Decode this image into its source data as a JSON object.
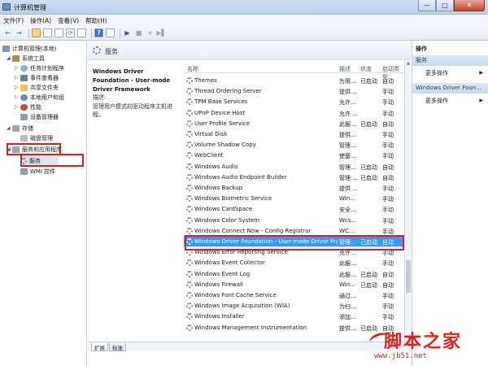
{
  "window": {
    "title": "计算机管理",
    "minimize": "—",
    "maximize": "□",
    "close": "✕"
  },
  "menu": [
    "文件(F)",
    "操作(A)",
    "查看(V)",
    "帮助(H)"
  ],
  "toolbar": {
    "back": "←",
    "forward": "→",
    "play": "▶",
    "stop": "■",
    "pause": "⏸",
    "restart": "▶▌"
  },
  "tree": {
    "root": "计算机管理(本地)",
    "system_tools": "系统工具",
    "task_scheduler": "任务计划程序",
    "event_viewer": "事件查看器",
    "shared_folders": "共享文件夹",
    "local_users": "本地用户和组",
    "performance": "性能",
    "device_manager": "设备管理器",
    "storage": "存储",
    "disk_mgmt": "磁盘管理",
    "services_apps": "服务和应用程序",
    "services": "服务",
    "wmi": "WMI 控件"
  },
  "center": {
    "header": "服务",
    "selected_name": "Windows Driver Foundation - User-mode Driver Framework",
    "desc_label": "描述:",
    "desc_text": "管理用户模式的驱动程序主机进程。"
  },
  "columns": {
    "name": "名称",
    "desc": "描述",
    "status": "状态",
    "startup": "启动类型"
  },
  "services": [
    {
      "name": "Themes",
      "desc": "为用...",
      "status": "已启动",
      "startup": "自动"
    },
    {
      "name": "Thread Ordering Server",
      "desc": "提供...",
      "status": "",
      "startup": "手动"
    },
    {
      "name": "TPM Base Services",
      "desc": "允许...",
      "status": "",
      "startup": "手动"
    },
    {
      "name": "UPnP Device Host",
      "desc": "允许 ...",
      "status": "",
      "startup": "手动"
    },
    {
      "name": "User Profile Service",
      "desc": "此服...",
      "status": "已启动",
      "startup": "自动"
    },
    {
      "name": "Virtual Disk",
      "desc": "提供...",
      "status": "",
      "startup": "手动"
    },
    {
      "name": "Volume Shadow Copy",
      "desc": "管理...",
      "status": "",
      "startup": "手动"
    },
    {
      "name": "WebClient",
      "desc": "使基...",
      "status": "",
      "startup": "手动"
    },
    {
      "name": "Windows Audio",
      "desc": "管理...",
      "status": "已启动",
      "startup": "自动"
    },
    {
      "name": "Windows Audio Endpoint Builder",
      "desc": "管理 ...",
      "status": "已启动",
      "startup": "自动"
    },
    {
      "name": "Windows Backup",
      "desc": "提供 ...",
      "status": "",
      "startup": "手动"
    },
    {
      "name": "Windows Biometric Service",
      "desc": "Win...",
      "status": "",
      "startup": "手动"
    },
    {
      "name": "Windows CardSpace",
      "desc": "安全...",
      "status": "",
      "startup": "手动"
    },
    {
      "name": "Windows Color System",
      "desc": "Wcs...",
      "status": "",
      "startup": "手动"
    },
    {
      "name": "Windows Connect Now - Config Registrar",
      "desc": "WC...",
      "status": "",
      "startup": "手动"
    },
    {
      "name": "Windows Driver Foundation - User-mode Driver Fra...",
      "desc": "管理...",
      "status": "已启动",
      "startup": "自动"
    },
    {
      "name": "Windows Error Reporting Service",
      "desc": "允许...",
      "status": "",
      "startup": "手动"
    },
    {
      "name": "Windows Event Collector",
      "desc": "此服...",
      "status": "",
      "startup": "手动"
    },
    {
      "name": "Windows Event Log",
      "desc": "此服...",
      "status": "已启动",
      "startup": "自动"
    },
    {
      "name": "Windows Firewall",
      "desc": "Win...",
      "status": "已启动",
      "startup": "自动"
    },
    {
      "name": "Windows Font Cache Service",
      "desc": "通过...",
      "status": "",
      "startup": "手动"
    },
    {
      "name": "Windows Image Acquisition (WIA)",
      "desc": "为扫...",
      "status": "",
      "startup": "手动"
    },
    {
      "name": "Windows Installer",
      "desc": "添加...",
      "status": "",
      "startup": "手动"
    },
    {
      "name": "Windows Management Instrumentation",
      "desc": "提供...",
      "status": "已启动",
      "startup": "自动"
    }
  ],
  "tabs": {
    "extended": "扩展",
    "standard": "标准"
  },
  "actions": {
    "title": "操作",
    "section1": "服务",
    "more1": "更多操作",
    "section2": "Windows Driver Foun...",
    "more2": "更多操作"
  },
  "watermark": {
    "big": "脚本之家",
    "small": "www.jb51.net"
  },
  "colors": {
    "selection": "#3399ff",
    "highlight_box": "#d0212a",
    "watermark": "#e0201a"
  }
}
